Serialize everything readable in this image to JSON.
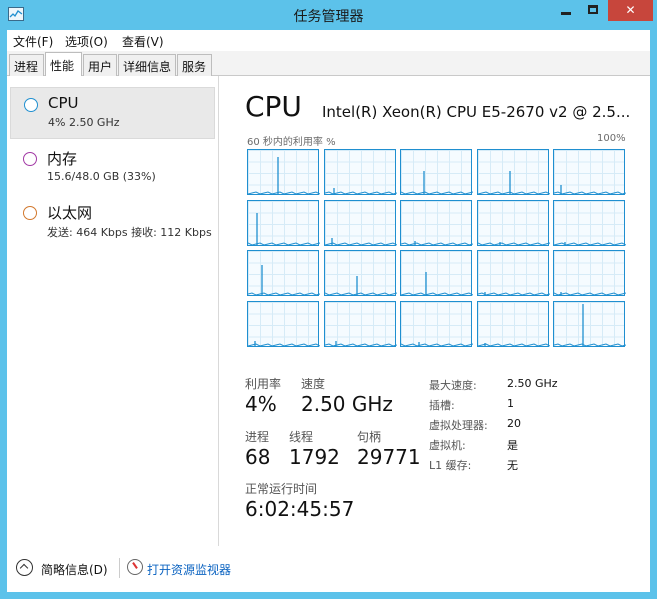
{
  "window": {
    "title": "任务管理器",
    "close_label": "✕"
  },
  "menu": [
    "文件(F)",
    "选项(O)",
    "查看(V)"
  ],
  "tabs": [
    "进程",
    "性能",
    "用户",
    "详细信息",
    "服务"
  ],
  "sidebar": [
    {
      "title": "CPU",
      "sub": "4% 2.50 GHz",
      "color": "#1f8fd0"
    },
    {
      "title": "内存",
      "sub": "15.6/48.0 GB (33%)",
      "color": "#a23aa5"
    },
    {
      "title": "以太网",
      "sub": "发送: 464 Kbps 接收: 112 Kbps",
      "color": "#d2782d"
    }
  ],
  "main": {
    "title": "CPU",
    "model": "Intel(R) Xeon(R) CPU E5-2670 v2 @ 2.5...",
    "graph_left_label": "60 秒内的利用率 %",
    "graph_right_label": "100%",
    "core_count": 20
  },
  "stats": {
    "utilization_label": "利用率",
    "utilization": "4%",
    "speed_label": "速度",
    "speed": "2.50 GHz",
    "processes_label": "进程",
    "processes": "68",
    "threads_label": "线程",
    "threads": "1792",
    "handles_label": "句柄",
    "handles": "29771",
    "uptime_label": "正常运行时间",
    "uptime": "6:02:45:57"
  },
  "info": [
    {
      "label": "最大速度:",
      "value": "2.50 GHz"
    },
    {
      "label": "插槽:",
      "value": "1"
    },
    {
      "label": "虚拟处理器:",
      "value": "20"
    },
    {
      "label": "虚拟机:",
      "value": "是"
    },
    {
      "label": "L1 缓存:",
      "value": "无"
    }
  ],
  "footer": {
    "brief": "简略信息(D)",
    "open_monitor": "打开资源监视器"
  }
}
